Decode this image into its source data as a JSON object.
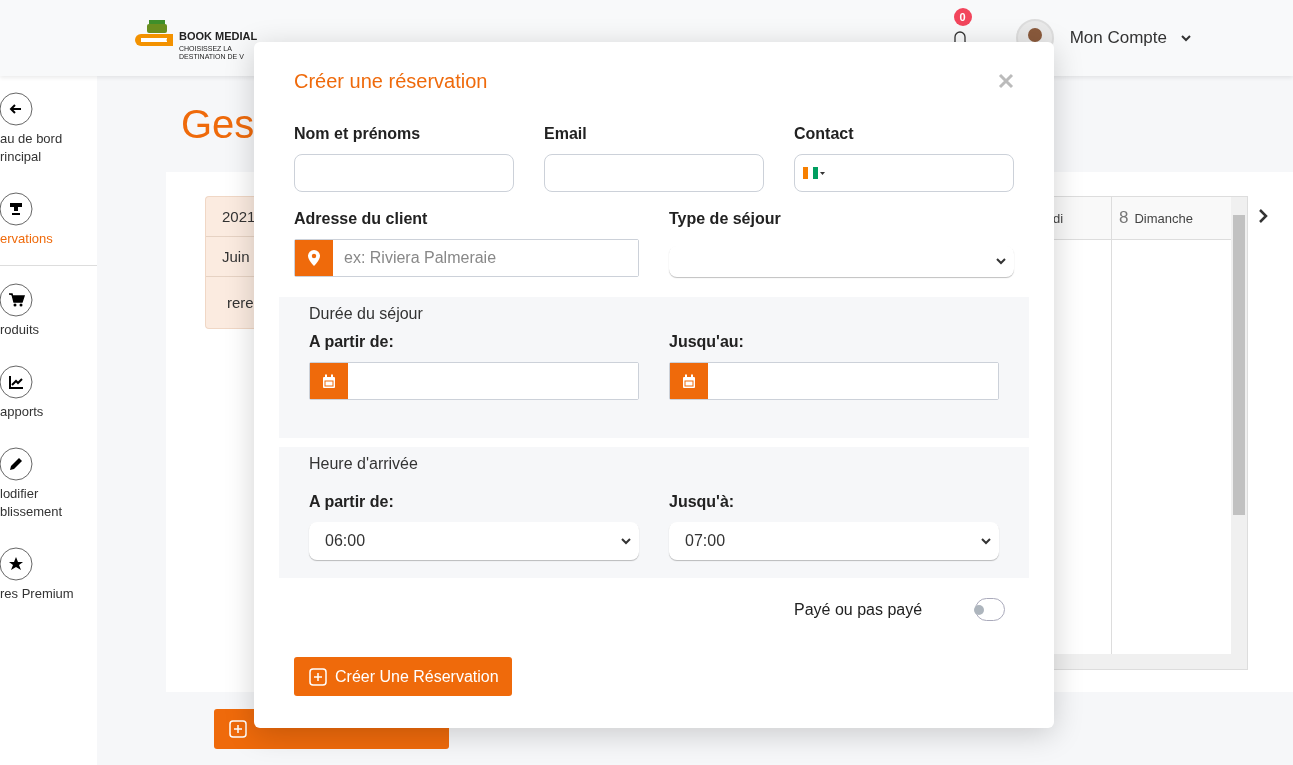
{
  "header": {
    "logo": {
      "title": "BOOK MEDIAL",
      "tagline": "CHOISISSEZ LA DESTINATION DE V"
    },
    "notifications": {
      "count": "0"
    },
    "account": {
      "label": "Mon Compte"
    }
  },
  "sidebar": {
    "items": [
      {
        "lines": [
          "au de bord",
          "rincipal"
        ],
        "selected": false
      },
      {
        "lines": [
          "ervations"
        ],
        "selected": true
      },
      {
        "lines": [
          "roduits"
        ],
        "selected": false
      },
      {
        "lines": [
          "apports"
        ],
        "selected": false
      },
      {
        "lines": [
          "lodifier",
          "blissement"
        ],
        "selected": false
      },
      {
        "lines": [
          "res Premium"
        ],
        "selected": false
      }
    ]
  },
  "page": {
    "title": "Ges",
    "calendar": {
      "left_cells": [
        "2021",
        "Juin",
        "rere"
      ],
      "day_headers": [
        {
          "label": "di"
        },
        {
          "number": "8",
          "label": "Dimanche"
        }
      ]
    }
  },
  "modal": {
    "title": "Créer une réservation",
    "fields": [
      {
        "label": "Nom et prénoms",
        "kind": "text"
      },
      {
        "label": "Email",
        "kind": "text"
      },
      {
        "label": "Contact",
        "kind": "phone"
      }
    ],
    "address": {
      "label": "Adresse du client",
      "placeholder": "ex: Riviera Palmeraie"
    },
    "stay_type": {
      "label": "Type de séjour"
    },
    "duration": {
      "heading": "Durée du séjour",
      "from_label": "A partir de:",
      "to_label": "Jusqu'au:"
    },
    "arrival": {
      "heading": "Heure d'arrivée",
      "from_label": "A partir de:",
      "from_value": "06:00",
      "to_label": "Jusqu'à:",
      "to_value": "07:00"
    },
    "paid": {
      "label": "Payé ou pas payé",
      "on": false
    },
    "submit": "Créer Une Réservation"
  }
}
